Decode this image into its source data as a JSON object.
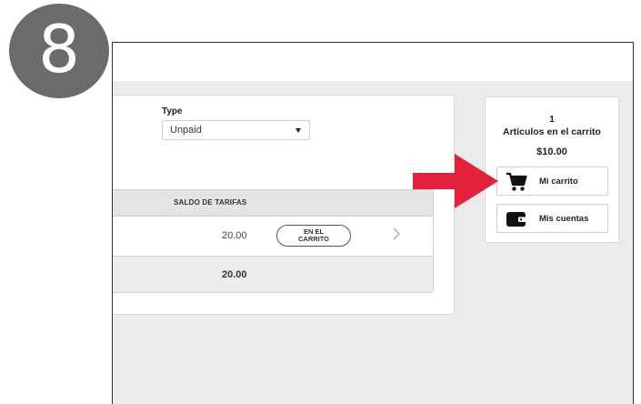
{
  "step": {
    "number": "8"
  },
  "filters": {
    "type_label": "Type",
    "type_value": "Unpaid"
  },
  "table": {
    "column_saldo": "SALDO DE TARIFAS",
    "row": {
      "amount": "20.00",
      "status_line1": "EN EL",
      "status_line2": "CARRITO"
    },
    "total": "20.00"
  },
  "cart": {
    "count": "1",
    "label": "Artículos en el carrito",
    "total": "$10.00",
    "mi_carrito_label": "Mi carrito",
    "mis_cuentas_label": "Mis cuentas"
  },
  "icons": {
    "cart": "shopping-cart-icon",
    "wallet": "wallet-icon",
    "chevron": "chevron-right-icon",
    "dropdown": "caret-down-icon"
  },
  "colors": {
    "step_badge": "#6b6b6b",
    "pointer_arrow": "#e3213a",
    "background": "#ebebeb",
    "card": "#ffffff"
  }
}
